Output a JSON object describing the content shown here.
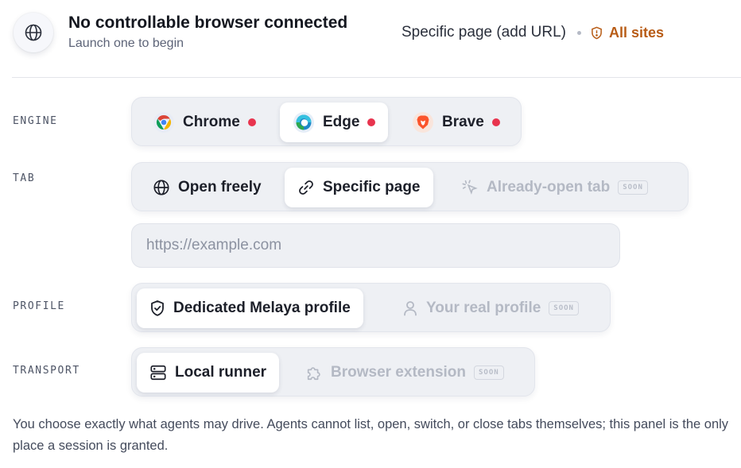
{
  "header": {
    "title": "No controllable browser connected",
    "subtitle": "Launch one to begin",
    "scope_text": "Specific page (add URL)",
    "scope_link": "All sites"
  },
  "engine": {
    "label": "ENGINE",
    "options": [
      {
        "label": "Chrome",
        "icon": "chrome-icon",
        "status": "not-connected",
        "active": false
      },
      {
        "label": "Edge",
        "icon": "edge-icon",
        "status": "not-connected",
        "active": true
      },
      {
        "label": "Brave",
        "icon": "brave-icon",
        "status": "not-connected",
        "active": false
      }
    ]
  },
  "tab": {
    "label": "TAB",
    "options": [
      {
        "label": "Open freely",
        "icon": "globe-icon",
        "active": false
      },
      {
        "label": "Specific page",
        "icon": "link-icon",
        "active": true
      },
      {
        "label": "Already-open tab",
        "icon": "pointer-click-icon",
        "disabled": true,
        "badge": "SOON"
      }
    ]
  },
  "url_input": {
    "placeholder": "https://example.com",
    "value": ""
  },
  "profile": {
    "label": "PROFILE",
    "options": [
      {
        "label": "Dedicated Melaya profile",
        "icon": "shield-check-icon",
        "active": true
      },
      {
        "label": "Your real profile",
        "icon": "user-icon",
        "disabled": true,
        "badge": "SOON"
      }
    ]
  },
  "transport": {
    "label": "TRANSPORT",
    "options": [
      {
        "label": "Local runner",
        "icon": "server-icon",
        "active": true
      },
      {
        "label": "Browser extension",
        "icon": "puzzle-icon",
        "disabled": true,
        "badge": "SOON"
      }
    ]
  },
  "footnote": "You choose exactly what agents may drive. Agents cannot list, open, switch, or close tabs themselves; this panel is the only place a session is granted.",
  "colors": {
    "accent": "#b85c16",
    "status_dot": "#e8344e",
    "disabled_text": "#b4b9c4",
    "segment_bg": "#eef0f4"
  }
}
